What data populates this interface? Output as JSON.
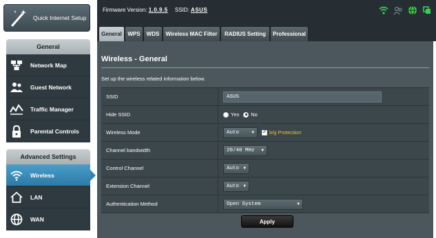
{
  "sidebar": {
    "quick_setup_label": "Quick Internet Setup",
    "general_header": "General",
    "general_items": [
      {
        "label": "Network Map",
        "icon": "network-map-icon"
      },
      {
        "label": "Guest Network",
        "icon": "guest-network-icon"
      },
      {
        "label": "Traffic Manager",
        "icon": "traffic-manager-icon"
      },
      {
        "label": "Parental Controls",
        "icon": "lock-icon"
      }
    ],
    "advanced_header": "Advanced Settings",
    "advanced_items": [
      {
        "label": "Wireless",
        "icon": "wifi-icon",
        "active": true
      },
      {
        "label": "LAN",
        "icon": "home-icon"
      },
      {
        "label": "WAN",
        "icon": "globe-icon"
      }
    ]
  },
  "header": {
    "firmware_label": "Firmware Version:",
    "firmware_value": "1.0.9.5",
    "ssid_label": "SSID:",
    "ssid_value": "ASUS"
  },
  "tabs": [
    {
      "label": "General",
      "active": true
    },
    {
      "label": "WPS"
    },
    {
      "label": "WDS"
    },
    {
      "label": "Wireless MAC Filter"
    },
    {
      "label": "RADIUS Setting"
    },
    {
      "label": "Professional"
    }
  ],
  "main": {
    "title": "Wireless - General",
    "description": "Set up the wireless related information below.",
    "fields": {
      "ssid": {
        "label": "SSID",
        "value": "ASUS"
      },
      "hide_ssid": {
        "label": "Hide SSID",
        "yes": "Yes",
        "no": "No",
        "selected": "No"
      },
      "wireless_mode": {
        "label": "Wireless Mode",
        "value": "Auto",
        "checkbox_label": "b/g Protection",
        "checked": true
      },
      "channel_bandwidth": {
        "label": "Channel bandwidth",
        "value": "20/40 MHz"
      },
      "control_channel": {
        "label": "Control Channel",
        "value": "Auto"
      },
      "extension_channel": {
        "label": "Extension Channel",
        "value": "Auto"
      },
      "auth_method": {
        "label": "Authentication Method",
        "value": "Open System"
      }
    },
    "apply_label": "Apply"
  },
  "colors": {
    "accent": "#2d7aa6",
    "panel": "#4b575d",
    "warning_text": "#f2c230"
  }
}
